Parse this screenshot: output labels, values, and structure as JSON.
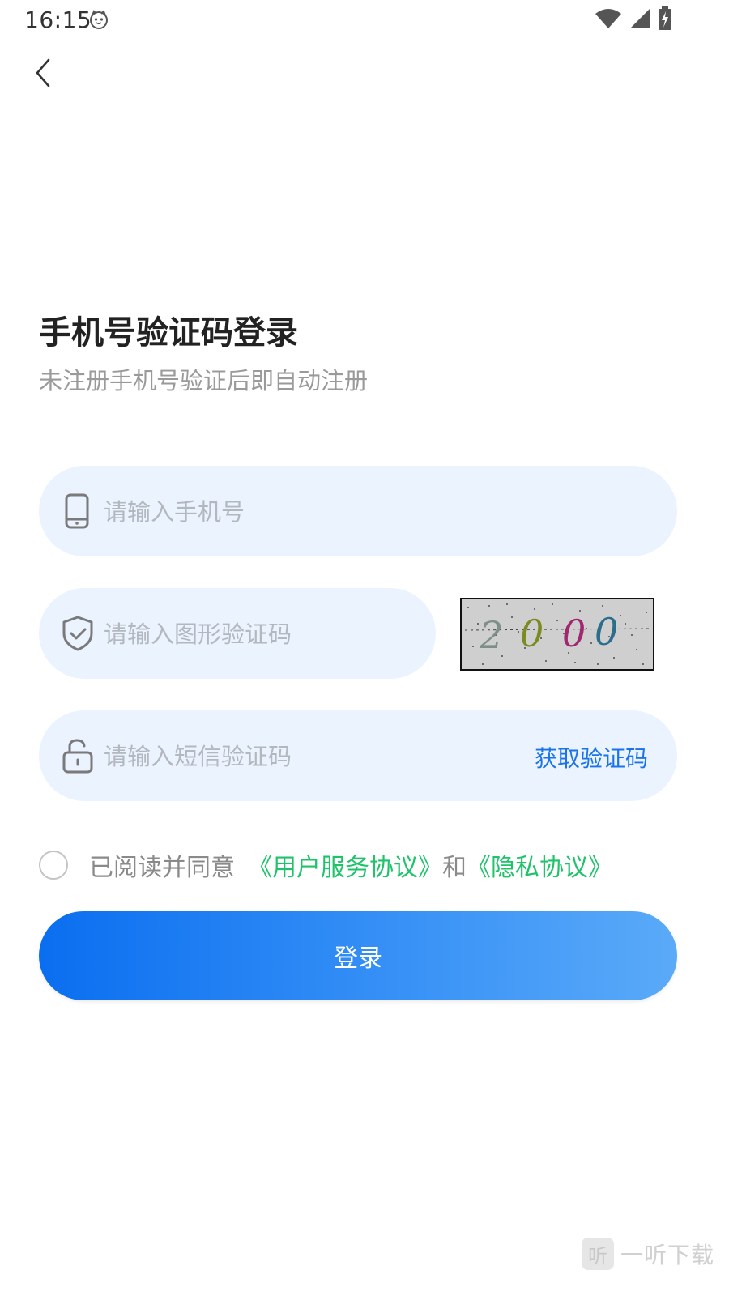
{
  "status_bar": {
    "time": "16:15"
  },
  "header": {
    "back_icon": "chevron-left-icon"
  },
  "title": "手机号验证码登录",
  "subtitle": "未注册手机号验证后即自动注册",
  "phone": {
    "placeholder": "请输入手机号",
    "value": "",
    "icon": "phone-icon"
  },
  "captcha": {
    "placeholder": "请输入图形验证码",
    "value": "",
    "icon": "shield-check-icon",
    "image_text": "2000"
  },
  "sms": {
    "placeholder": "请输入短信验证码",
    "value": "",
    "icon": "unlock-icon",
    "get_code_label": "获取验证码"
  },
  "agreement": {
    "prefix": "已阅读并同意",
    "terms_link": "《用户服务协议》",
    "and": "和",
    "privacy_link": "《隐私协议》",
    "checked": false
  },
  "login_button": "登录",
  "watermark": {
    "badge": "听",
    "text": "一听下载"
  },
  "colors": {
    "accent": "#1a73e8",
    "link_green": "#1fc36a",
    "field_bg": "#ebf3ff",
    "button_gradient_start": "#0a6ef0",
    "button_gradient_end": "#5aaaf8"
  }
}
